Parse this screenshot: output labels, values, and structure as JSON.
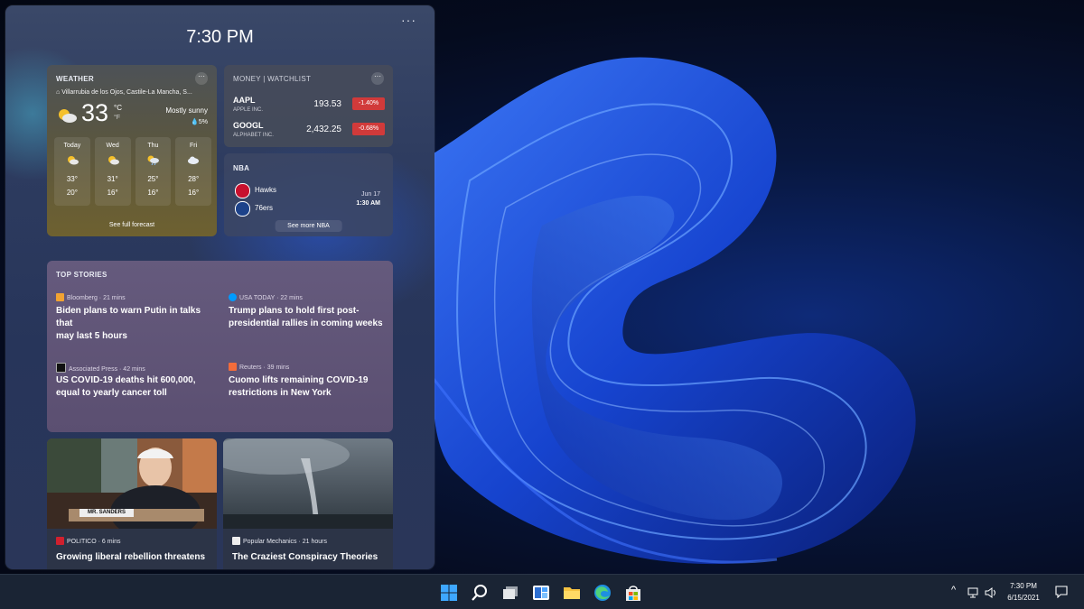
{
  "panel": {
    "clock": "7:30 PM",
    "more": "···"
  },
  "weather": {
    "header": "WEATHER",
    "location": "Villarrubia de los Ojos, Castile-La Mancha, S...",
    "temp": "33",
    "unit_c": "°C",
    "unit_f": "°F",
    "condition": "Mostly sunny",
    "precip": "💧5%",
    "days": [
      {
        "name": "Today",
        "high": "33°",
        "low": "20°"
      },
      {
        "name": "Wed",
        "high": "31°",
        "low": "16°"
      },
      {
        "name": "Thu",
        "high": "25°",
        "low": "16°"
      },
      {
        "name": "Fri",
        "high": "28°",
        "low": "16°"
      }
    ],
    "forecast_link": "See full forecast"
  },
  "money": {
    "header": "MONEY | WATCHLIST",
    "stocks": [
      {
        "symbol": "AAPL",
        "name": "APPLE INC.",
        "price": "193.53",
        "change": "-1.40%"
      },
      {
        "symbol": "GOOGL",
        "name": "ALPHABET INC.",
        "price": "2,432.25",
        "change": "-0.68%"
      }
    ]
  },
  "nba": {
    "header": "NBA",
    "team1": "Hawks",
    "team2": "76ers",
    "date": "Jun 17",
    "time": "1:30 AM",
    "more_link": "See more NBA"
  },
  "stories": {
    "header": "TOP STORIES",
    "items": [
      {
        "source": "Bloomberg · 21 mins",
        "title_l1": "Biden plans to warn Putin in talks that",
        "title_l2": "may last 5 hours"
      },
      {
        "source": "USA TODAY · 22 mins",
        "title_l1": "Trump plans to hold first post-",
        "title_l2": "presidential rallies in coming weeks"
      },
      {
        "source": "Associated Press · 42 mins",
        "title_l1": "US COVID-19 deaths hit 600,000,",
        "title_l2": "equal to yearly cancer toll"
      },
      {
        "source": "Reuters · 39 mins",
        "title_l1": "Cuomo lifts remaining COVID-19",
        "title_l2": "restrictions in New York"
      }
    ]
  },
  "image_cards": [
    {
      "source": "POLITICO · 6 mins",
      "title": "Growing liberal rebellion threatens",
      "placard": "MR. SANDERS"
    },
    {
      "source": "Popular Mechanics · 21 hours",
      "title": "The Craziest Conspiracy Theories"
    }
  ],
  "taskbar": {
    "time": "7:30 PM",
    "date": "6/15/2021"
  },
  "colors": {
    "accent": "#0078d4",
    "negative": "#d13a3a"
  }
}
